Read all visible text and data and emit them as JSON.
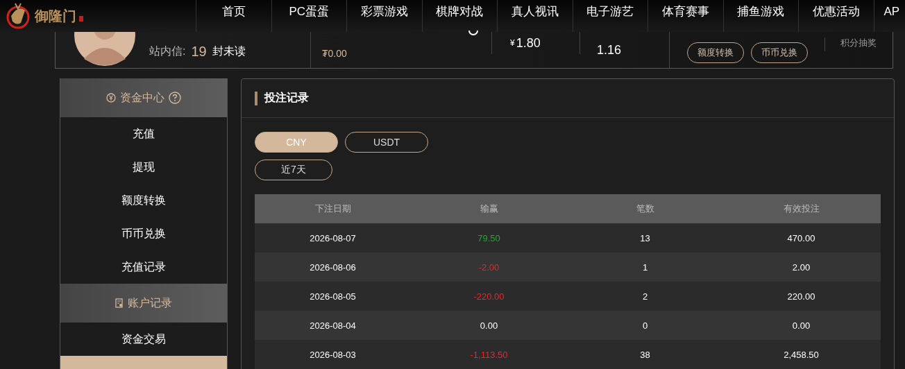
{
  "logo": {
    "text": "御隆门"
  },
  "nav": [
    {
      "label": "首页"
    },
    {
      "label": "PC蛋蛋"
    },
    {
      "label": "彩票游戏"
    },
    {
      "label": "棋牌对战"
    },
    {
      "label": "真人视讯"
    },
    {
      "label": "电子游艺"
    },
    {
      "label": "体育赛事"
    },
    {
      "label": "捕鱼游戏"
    },
    {
      "label": "优惠活动"
    },
    {
      "label": "AP"
    }
  ],
  "profile": {
    "mail_label": "站内信:",
    "mail_count": "19",
    "mail_suffix": "封未读",
    "usdt_balance": "₮0.00",
    "cny_symbol": "¥",
    "cny_balance": "1.80",
    "points": "1.16",
    "buttons": [
      "额度转换",
      "币币兑换"
    ],
    "lottery": "积分抽奖"
  },
  "sidebar": [
    {
      "title": "资金中心",
      "items": [
        {
          "label": "充值",
          "selected": false
        },
        {
          "label": "提现",
          "selected": false
        },
        {
          "label": "额度转换",
          "selected": false
        },
        {
          "label": "币币兑换",
          "selected": false
        },
        {
          "label": "充值记录",
          "selected": false
        }
      ]
    },
    {
      "title": "账户记录",
      "items": [
        {
          "label": "资金交易",
          "selected": false
        },
        {
          "selected": true
        }
      ]
    }
  ],
  "panel": {
    "title": "投注记录",
    "currencies": [
      {
        "label": "CNY",
        "selected": true
      },
      {
        "label": "USDT",
        "selected": false
      }
    ],
    "range": "近7天"
  },
  "table": {
    "columns": [
      "下注日期",
      "输赢",
      "笔数",
      "有效投注"
    ],
    "rows": [
      {
        "date": "2026-08-07",
        "win_loss": "79.50",
        "color": "#1aab2e",
        "count": "13",
        "valid_bet": "470.00"
      },
      {
        "date": "2026-08-06",
        "win_loss": "-2.00",
        "color": "#e8262b",
        "count": "1",
        "valid_bet": "2.00"
      },
      {
        "date": "2026-08-05",
        "win_loss": "-220.00",
        "color": "#e8262b",
        "count": "2",
        "valid_bet": "220.00"
      },
      {
        "date": "2026-08-04",
        "win_loss": "0.00",
        "color": "#ffffff",
        "count": "0",
        "valid_bet": "0.00"
      },
      {
        "date": "2026-08-03",
        "win_loss": "-1,113.50",
        "color": "#e8262b",
        "count": "38",
        "valid_bet": "2,458.50"
      }
    ]
  }
}
